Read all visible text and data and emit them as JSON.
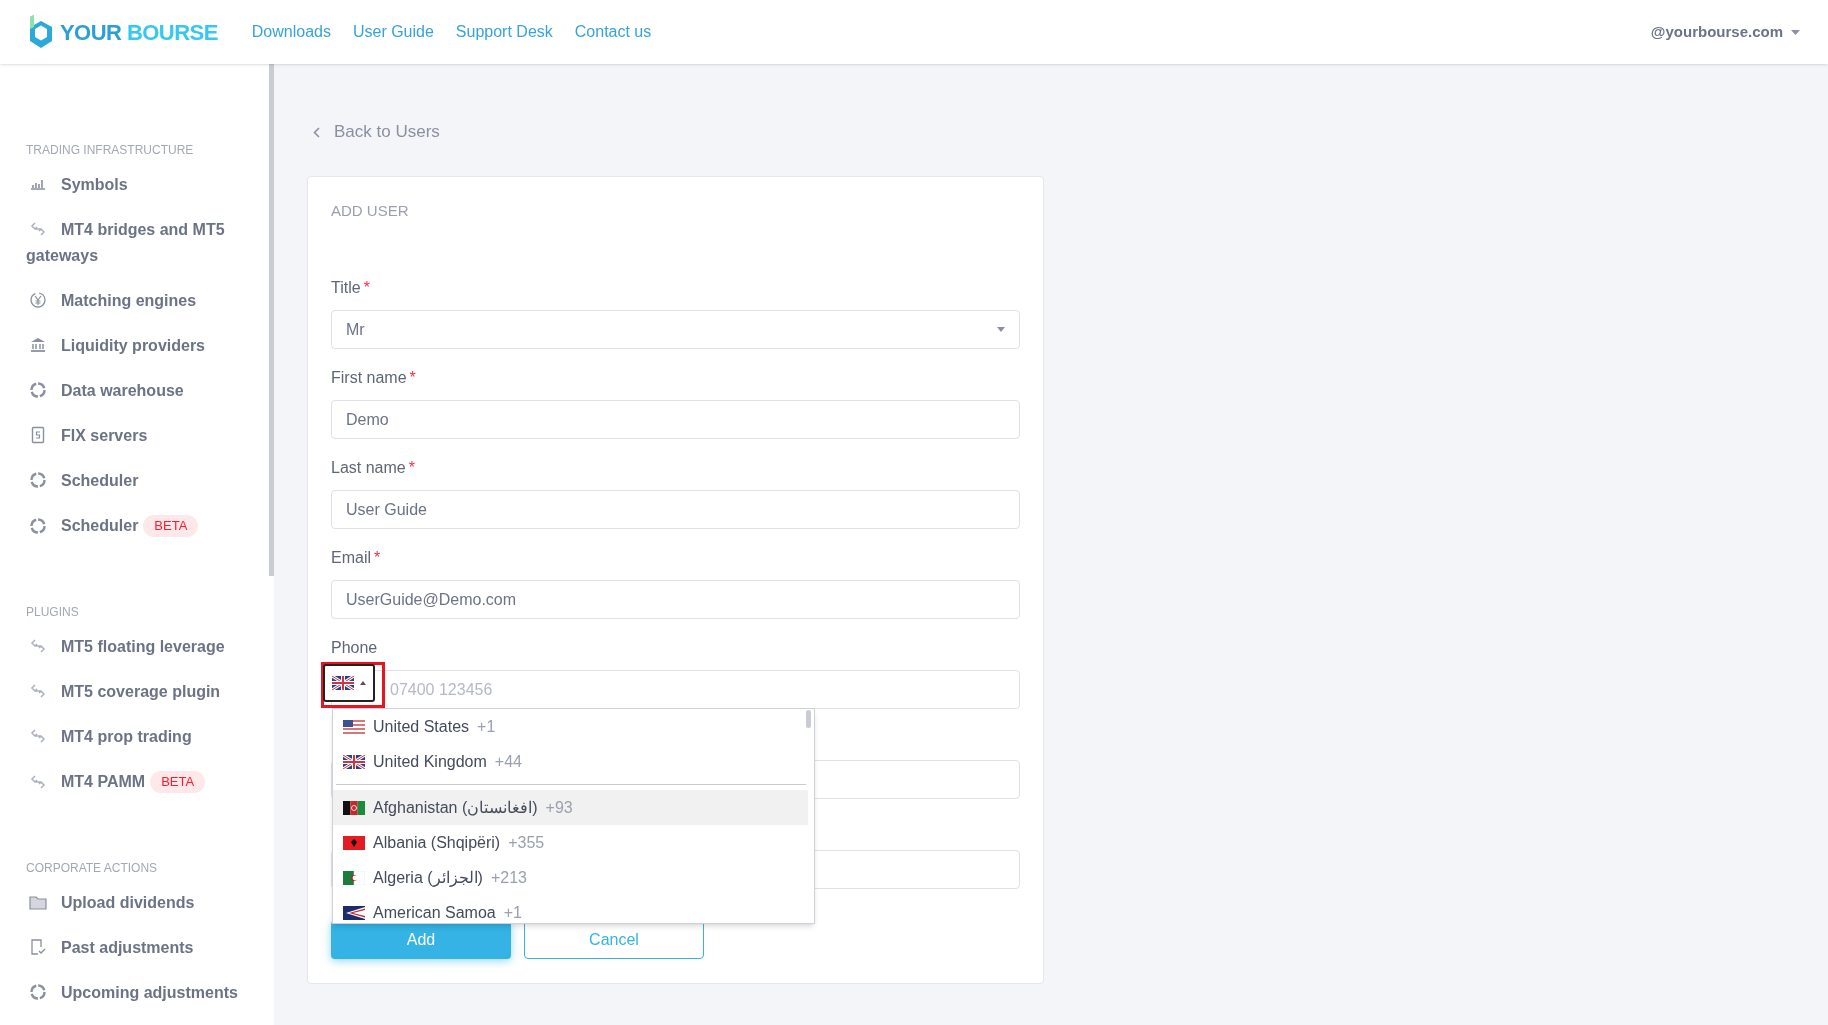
{
  "header": {
    "logo": {
      "part1": "YOUR",
      "part2": "BOURSE"
    },
    "nav": [
      "Downloads",
      "User Guide",
      "Support Desk",
      "Contact us"
    ],
    "account": "@yourbourse.com"
  },
  "sidebar": {
    "sections": [
      {
        "title": "TRADING INFRASTRUCTURE",
        "items": [
          {
            "label": "Symbols",
            "kind": "bars"
          },
          {
            "label": "MT4 bridges and MT5 gateways",
            "kind": "link"
          },
          {
            "label": "Matching engines",
            "kind": "yen"
          },
          {
            "label": "Liquidity providers",
            "kind": "bank"
          },
          {
            "label": "Data warehouse",
            "kind": "ring"
          },
          {
            "label": "FIX servers",
            "kind": "doc"
          },
          {
            "label": "Scheduler",
            "kind": "ring"
          },
          {
            "label": "Scheduler",
            "kind": "ring",
            "badge": "BETA"
          }
        ]
      },
      {
        "title": "PLUGINS",
        "items": [
          {
            "label": "MT5 floating leverage",
            "kind": "link"
          },
          {
            "label": "MT5 coverage plugin",
            "kind": "link"
          },
          {
            "label": "MT4 prop trading",
            "kind": "link"
          },
          {
            "label": "MT4 PAMM",
            "kind": "link",
            "badge": "BETA"
          }
        ]
      },
      {
        "title": "CORPORATE ACTIONS",
        "items": [
          {
            "label": "Upload dividends",
            "kind": "folder"
          },
          {
            "label": "Past adjustments",
            "kind": "check"
          },
          {
            "label": "Upcoming adjustments",
            "kind": "ring"
          }
        ]
      }
    ]
  },
  "back_link": "Back to Users",
  "form": {
    "title": "ADD USER",
    "fields": [
      {
        "kind": "select",
        "label": "Title",
        "required": true,
        "required_mark": "*",
        "value": "Mr"
      },
      {
        "kind": "text",
        "label": "First name",
        "required": true,
        "required_mark": "*",
        "value": "Demo"
      },
      {
        "kind": "text",
        "label": "Last name",
        "required": true,
        "required_mark": "*",
        "value": "User Guide"
      },
      {
        "kind": "text",
        "label": "Email",
        "required": true,
        "required_mark": "*",
        "value": "UserGuide@Demo.com"
      },
      {
        "kind": "phone",
        "label": "Phone",
        "required": false,
        "placeholder": "07400 123456",
        "selected_flag": {
          "kind": "gb"
        }
      },
      {
        "kind": "hidden"
      },
      {
        "kind": "hidden"
      }
    ],
    "buttons": [
      {
        "label": "Add",
        "kind": "primary"
      },
      {
        "label": "Cancel",
        "kind": "outline"
      }
    ]
  },
  "country_dropdown": {
    "preferred": [
      {
        "name": "United States",
        "code": "+1",
        "kind": "us",
        "highlighted": false
      },
      {
        "name": "United Kingdom",
        "code": "+44",
        "kind": "gb",
        "highlighted": false
      }
    ],
    "countries": [
      {
        "name": "Afghanistan (‫افغانستان‬‎)",
        "code": "+93",
        "kind": "af",
        "highlighted": true
      },
      {
        "name": "Albania (Shqipëri)",
        "code": "+355",
        "kind": "al",
        "highlighted": false
      },
      {
        "name": "Algeria (‫الجزائر‬‎)",
        "code": "+213",
        "kind": "dz",
        "highlighted": false
      },
      {
        "name": "American Samoa",
        "code": "+1",
        "kind": "as",
        "highlighted": false
      }
    ]
  }
}
